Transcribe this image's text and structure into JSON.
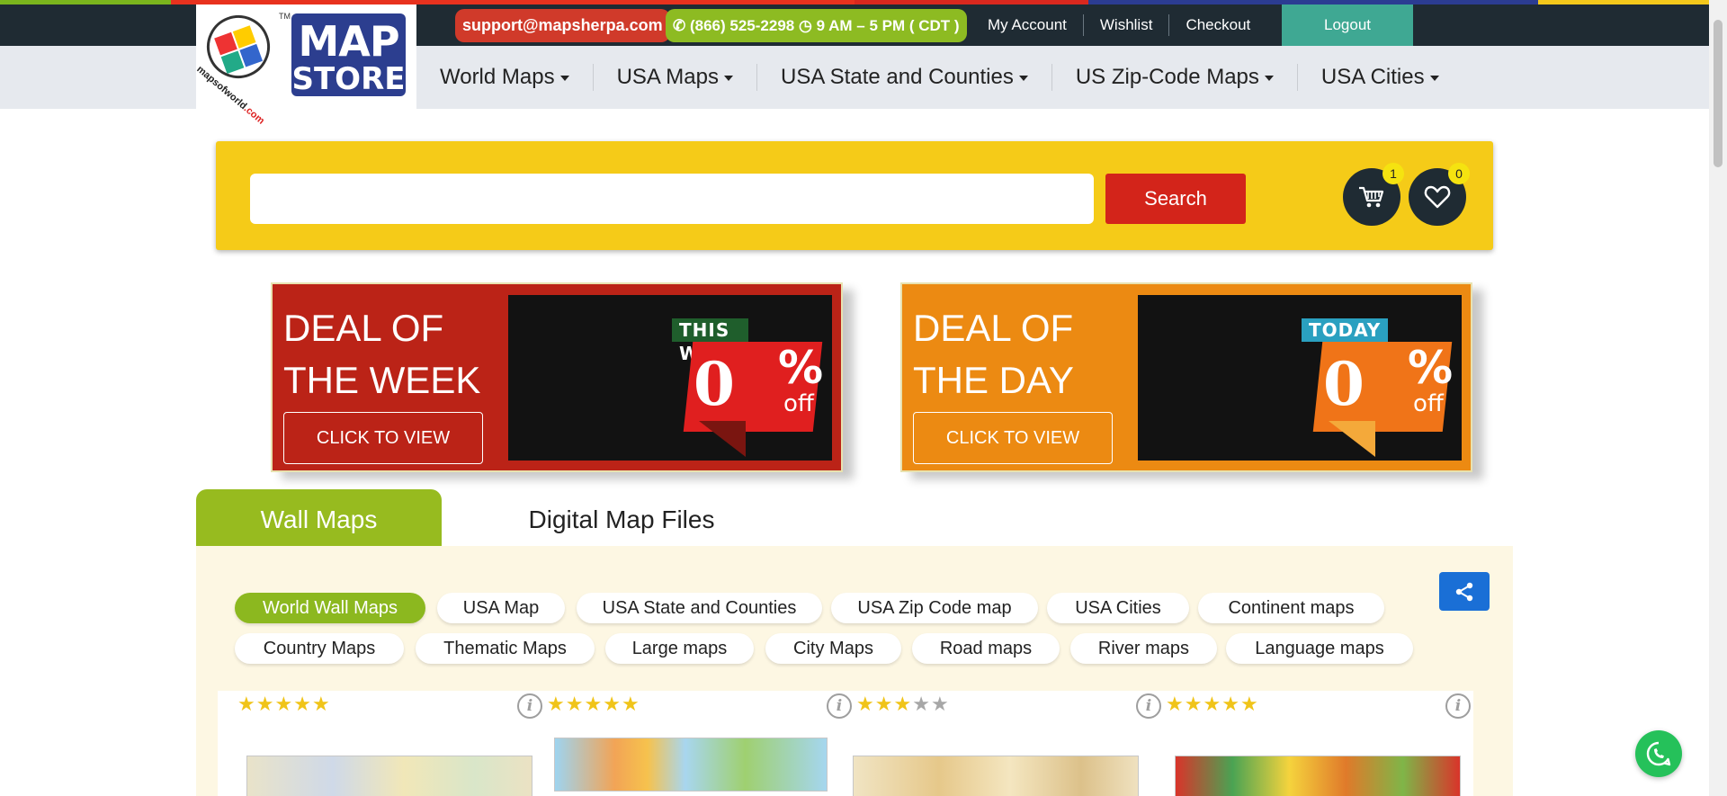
{
  "colors": {
    "rainbow": [
      "#7ab51d",
      "#e8321e",
      "#e3231f",
      "#2b3c92",
      "#f4c81b"
    ],
    "topbar": "#1f2b33",
    "accent_green": "#97bb1f",
    "search_yellow": "#f5cb18",
    "search_red": "#d3241a"
  },
  "logo": {
    "brand_line1": "MAP",
    "brand_line2": "STORE",
    "tm": "TM",
    "site_prefix": "mapsofworld",
    "site_suffix": ".com"
  },
  "topbar": {
    "email": "support@mapsherpa.com",
    "phone": "(866) 525-2298",
    "hours": "9 AM – 5 PM ( CDT )",
    "links": [
      "My Account",
      "Wishlist",
      "Checkout"
    ],
    "logout": "Logout"
  },
  "nav": {
    "items": [
      "World Maps",
      "USA Maps",
      "USA State and Counties",
      "US Zip-Code Maps",
      "USA Cities"
    ]
  },
  "search": {
    "value": "",
    "button": "Search",
    "cart_count": "1",
    "wishlist_count": "0"
  },
  "deals": {
    "week": {
      "line1": "DEAL OF",
      "line2": "THE WEEK",
      "cta": "CLICK TO VIEW",
      "tag_label": "THIS WEEK",
      "percent": "0",
      "pct_sign": "%",
      "off": "off"
    },
    "day": {
      "line1": "DEAL OF",
      "line2": "THE DAY",
      "cta": "CLICK TO VIEW",
      "tag_label": "TODAY",
      "percent": "0",
      "pct_sign": "%",
      "off": "off"
    }
  },
  "tabs": {
    "wall": "Wall Maps",
    "digital": "Digital Map Files"
  },
  "categories": [
    "World Wall Maps",
    "USA Map",
    "USA State and Counties",
    "USA Zip Code map",
    "USA Cities",
    "Continent maps",
    "Country Maps",
    "Thematic Maps",
    "Large maps",
    "City Maps",
    "Road maps",
    "River maps",
    "Language maps"
  ],
  "active_category": "World Wall Maps",
  "products": [
    {
      "rating": 5
    },
    {
      "rating": 5
    },
    {
      "rating": 3
    },
    {
      "rating": 5
    }
  ],
  "icons": [
    "phone-icon",
    "clock-icon",
    "cart-icon",
    "heart-icon",
    "share-icon",
    "info-icon",
    "whatsapp-icon"
  ]
}
